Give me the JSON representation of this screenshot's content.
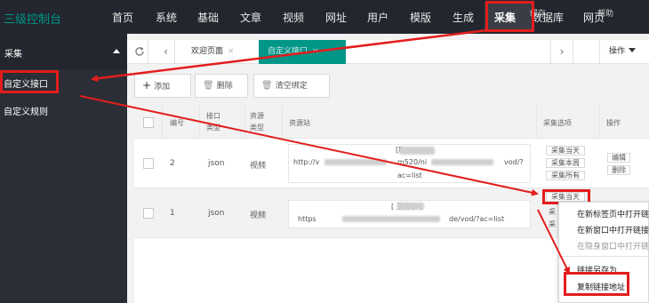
{
  "header": {
    "logo": "三级控制台",
    "nav": [
      "首页",
      "系统",
      "基础",
      "文章",
      "视频",
      "网址",
      "用户",
      "模版",
      "生成",
      "采集",
      "数据库",
      "网页"
    ],
    "nav_overlay": [
      "缓存",
      "帮助"
    ],
    "active": "采集"
  },
  "sidebar": {
    "title": "采集",
    "items": [
      "自定义接口",
      "自定义规则"
    ]
  },
  "tabbar": {
    "refresh_icon": "refresh-icon",
    "prev_icon": "chevron-left-icon",
    "next_icon": "chevron-right-icon",
    "tabs": [
      {
        "label": "欢迎页面",
        "close": "×"
      },
      {
        "label": "自定义接口",
        "close": "×"
      }
    ],
    "ops_label": "操作"
  },
  "toolbar": {
    "add_label": "添加",
    "delete_label": "删除",
    "clear_label": "清空绑定"
  },
  "table": {
    "headers": [
      "编号",
      "接口类型",
      "资源类型",
      "资源站",
      "采集选项",
      "操作"
    ],
    "rows": [
      {
        "id": "2",
        "api_type": "json",
        "res_type": "视频",
        "site_title": "[E",
        "url_start": "http://v",
        "url_mid": "m520/ni",
        "url_end": "vod/?",
        "url_tail": "ac=list",
        "options": [
          "采集当天",
          "采集本周",
          "采集所有"
        ],
        "actions": [
          "编辑",
          "删除"
        ]
      },
      {
        "id": "1",
        "api_type": "json",
        "res_type": "视频",
        "site_title": "[ 王宝示 ]",
        "url_start": "https",
        "url_end": "de/vod/?ac=list",
        "options": [
          "采集当天",
          "采",
          "采"
        ]
      }
    ]
  },
  "context_menu": {
    "items": [
      "在新标签页中打开链接",
      "在新窗口中打开链接",
      "在隐身窗口中打开链接",
      "链接另存为...",
      "复制链接地址"
    ]
  },
  "colors": {
    "topbar": "#23262e",
    "accent": "#009688",
    "highlight": "#e31d1d"
  }
}
